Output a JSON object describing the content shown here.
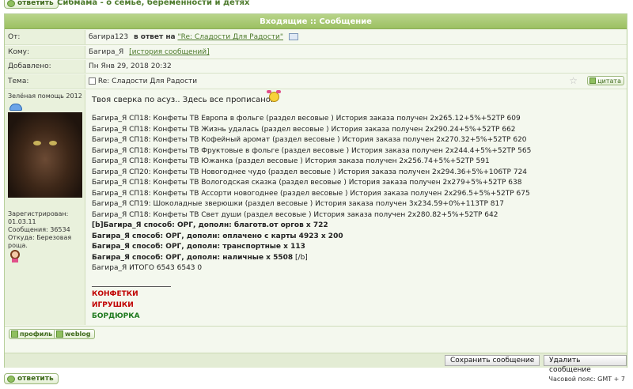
{
  "top": {
    "reply_label": "ответить",
    "breadcrumb": "Сибмама - о семье, беременности и детях"
  },
  "panel": {
    "title": "Входящие :: Сообщение"
  },
  "fields": {
    "from_label": "От:",
    "from_user": "багира123",
    "in_reply_to": "в ответ на",
    "reply_topic": "\"Re: Сладости Для Радости\"",
    "to_label": "Кому:",
    "to_user": "Багира_Я",
    "history_link": "[история сообщений]",
    "added_label": "Добавлено:",
    "added_value": "Пн Янв 29, 2018 20:32",
    "subject_label": "Тема:",
    "subject_value": "Re: Сладости Для Радости",
    "quote_label": "цитата"
  },
  "author": {
    "rank": "Зелёная помощь 2012",
    "registered_label": "Зарегистрирован:",
    "registered_value": "01.03.11",
    "posts": "Сообщения: 36534",
    "location": "Откуда: Березовая роща."
  },
  "message": {
    "intro": "Твоя сверка по асуз.. Здесь все прописано.",
    "lines": [
      "Багира_Я СП18: Конфеты ТВ Европа в фольге (раздел весовые ) История заказа получен 2х265.12+5%+52ТР 609",
      "Багира_Я СП18: Конфеты ТВ Жизнь удалась (раздел весовые ) История заказа получен 2х290.24+5%+52ТР 662",
      "Багира_Я СП18: Конфеты ТВ Кофейный аромат (раздел весовые ) История заказа получен 2х270.32+5%+52ТР 620",
      "Багира_Я СП18: Конфеты ТВ Фруктовые в фольге (раздел весовые ) История заказа получен 2х244.4+5%+52ТР 565",
      "Багира_Я СП18: Конфеты ТВ Южанка (раздел весовые ) История заказа получен 2х256.74+5%+52ТР 591",
      "Багира_Я СП20: Конфеты ТВ Новогоднее чудо (раздел весовые ) История заказа получен 2х294.36+5%+106ТР 724",
      "Багира_Я СП18: Конфеты ТВ Вологодская сказка (раздел весовые ) История заказа получен 2х279+5%+52ТР 638",
      "Багира_Я СП18: Конфеты ТВ Ассорти новогоднее (раздел весовые ) История заказа получен 2х296.5+5%+52ТР 675",
      "Багира_Я СП19: Шоколадные зверюшки (раздел весовые ) История заказа получен 3х234.59+0%+113ТР 817",
      "Багира_Я СП18: Конфеты ТВ Свет души (раздел весовые ) История заказа получен 2х280.82+5%+52ТР 642"
    ],
    "bold_lines": [
      "[b]Багира_Я способ: ОРГ, дополн: благотв.от оргов х 722",
      "Багира_Я способ: ОРГ, дополн: оплачено с карты 4923 х 200",
      "Багира_Я способ: ОРГ, дополн: транспортные х 113",
      "Багира_Я способ: ОРГ, дополн: наличные х 5508"
    ],
    "bold_tail": "[/b]",
    "total": "Багира_Я ИТОГО 6543 6543 0",
    "sig1": "КОНФЕТКИ",
    "sig2": "ИГРУШКИ",
    "sig3": "БОРДЮРКА"
  },
  "buttons": {
    "profile": "профиль",
    "weblog": "weblog",
    "save": "Сохранить сообщение",
    "delete": "Удалить сообщение",
    "bottom_reply": "ответить"
  },
  "footer": {
    "timezone": "Часовой пояс: GMT + 7"
  }
}
